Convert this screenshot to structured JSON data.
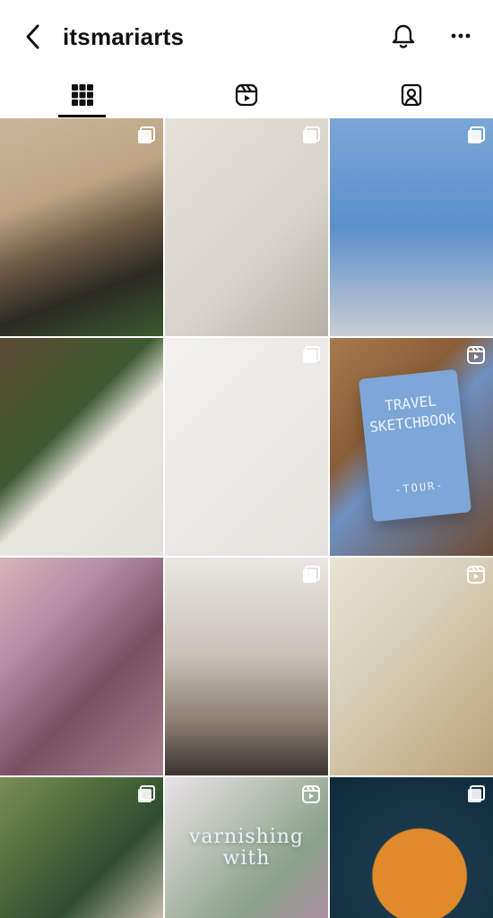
{
  "header": {
    "username": "itsmariarts"
  },
  "tabs": [
    {
      "name": "tab-grid",
      "icon": "grid-icon",
      "active": true
    },
    {
      "name": "tab-reels",
      "icon": "reels-icon",
      "active": false
    },
    {
      "name": "tab-tagged",
      "icon": "tagged-icon",
      "active": false
    }
  ],
  "posts": [
    {
      "type": "multiple",
      "badge_icon": "multiple-posts-icon"
    },
    {
      "type": "multiple",
      "badge_icon": "multiple-posts-icon"
    },
    {
      "type": "multiple",
      "badge_icon": "multiple-posts-icon"
    },
    {
      "type": "single",
      "badge_icon": ""
    },
    {
      "type": "multiple",
      "badge_icon": "multiple-posts-icon"
    },
    {
      "type": "reel",
      "badge_icon": "reel-icon"
    },
    {
      "type": "single",
      "badge_icon": ""
    },
    {
      "type": "multiple",
      "badge_icon": "multiple-posts-icon"
    },
    {
      "type": "reel",
      "badge_icon": "reel-icon"
    },
    {
      "type": "multiple",
      "badge_icon": "multiple-posts-icon"
    },
    {
      "type": "reel",
      "badge_icon": "reel-icon"
    },
    {
      "type": "multiple",
      "badge_icon": "multiple-posts-icon"
    }
  ],
  "post_text": {
    "travel_sketchbook": [
      "TRAVEL",
      "SKETCHBOOK",
      "-TOUR-"
    ],
    "overlay_11": [
      "varnishing",
      "with"
    ]
  },
  "colors": {
    "background": "#ffffff",
    "text": "#111111",
    "icon": "#111111",
    "tab_underline": "#111111"
  }
}
